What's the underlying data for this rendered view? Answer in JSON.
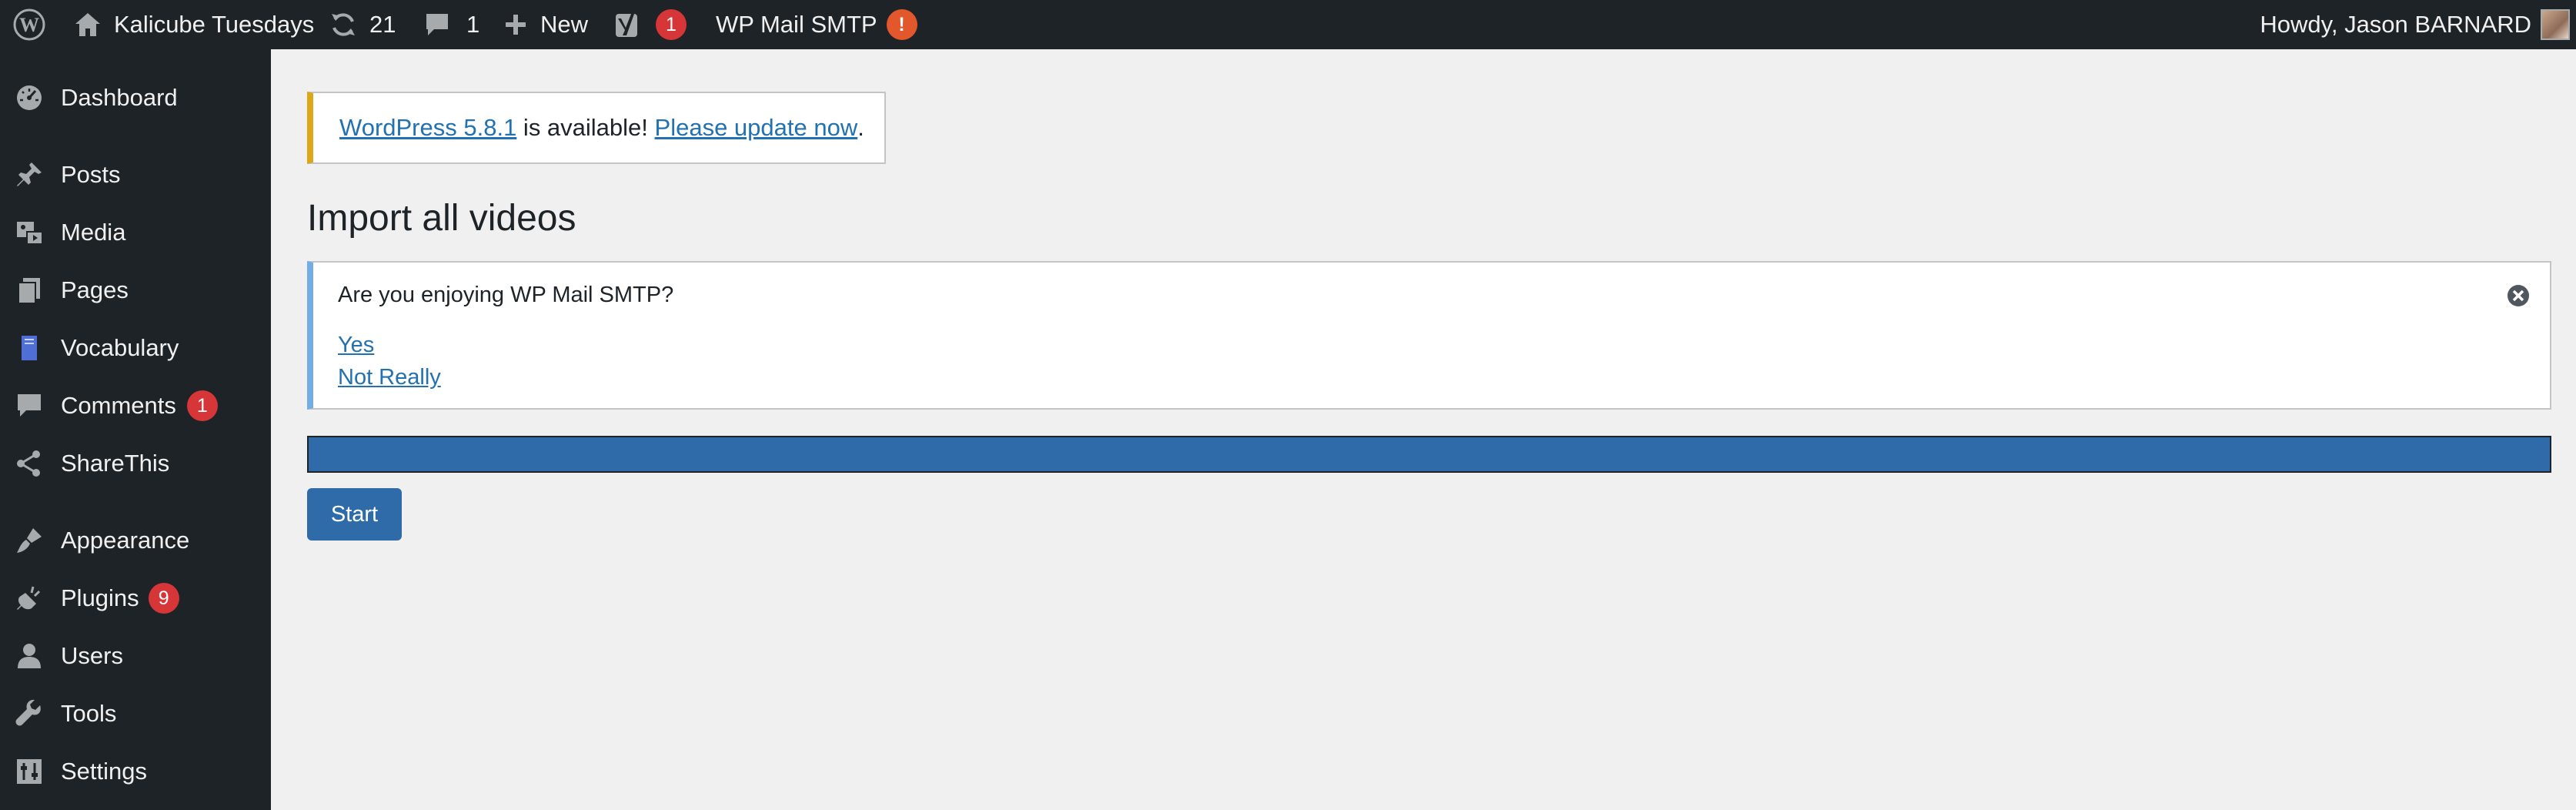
{
  "admin_bar": {
    "site_name": "Kalicube Tuesdays",
    "updates_count": "21",
    "comments_count": "1",
    "new_label": "New",
    "yoast_count": "1",
    "smtp_label": "WP Mail SMTP",
    "smtp_alert": "!",
    "greeting": "Howdy, Jason BARNARD"
  },
  "sidebar": {
    "items": [
      {
        "label": "Dashboard",
        "icon": "dashboard-icon"
      },
      {
        "label": "Posts",
        "icon": "pin-icon"
      },
      {
        "label": "Media",
        "icon": "media-icon"
      },
      {
        "label": "Pages",
        "icon": "pages-icon"
      },
      {
        "label": "Vocabulary",
        "icon": "book-icon"
      },
      {
        "label": "Comments",
        "icon": "comment-icon",
        "badge": "1"
      },
      {
        "label": "ShareThis",
        "icon": "share-icon"
      },
      {
        "label": "Appearance",
        "icon": "brush-icon"
      },
      {
        "label": "Plugins",
        "icon": "plugin-icon",
        "badge": "9"
      },
      {
        "label": "Users",
        "icon": "user-icon"
      },
      {
        "label": "Tools",
        "icon": "wrench-icon"
      },
      {
        "label": "Settings",
        "icon": "settings-icon"
      }
    ]
  },
  "update_notice": {
    "version_link": "WordPress 5.8.1",
    "middle_text": " is available! ",
    "update_link": "Please update now",
    "end_text": "."
  },
  "page_title": "Import all videos",
  "smtp_notice": {
    "question": "Are you enjoying WP Mail SMTP?",
    "yes": "Yes",
    "no": "Not Really"
  },
  "progress": {
    "fraction": 1.0
  },
  "start_button": "Start",
  "colors": {
    "admin_bg": "#1d2327",
    "link": "#2271b1",
    "primary_button": "#2e6ba8",
    "badge": "#d63638",
    "notice_warning": "#dba617",
    "notice_info": "#72aee6"
  }
}
